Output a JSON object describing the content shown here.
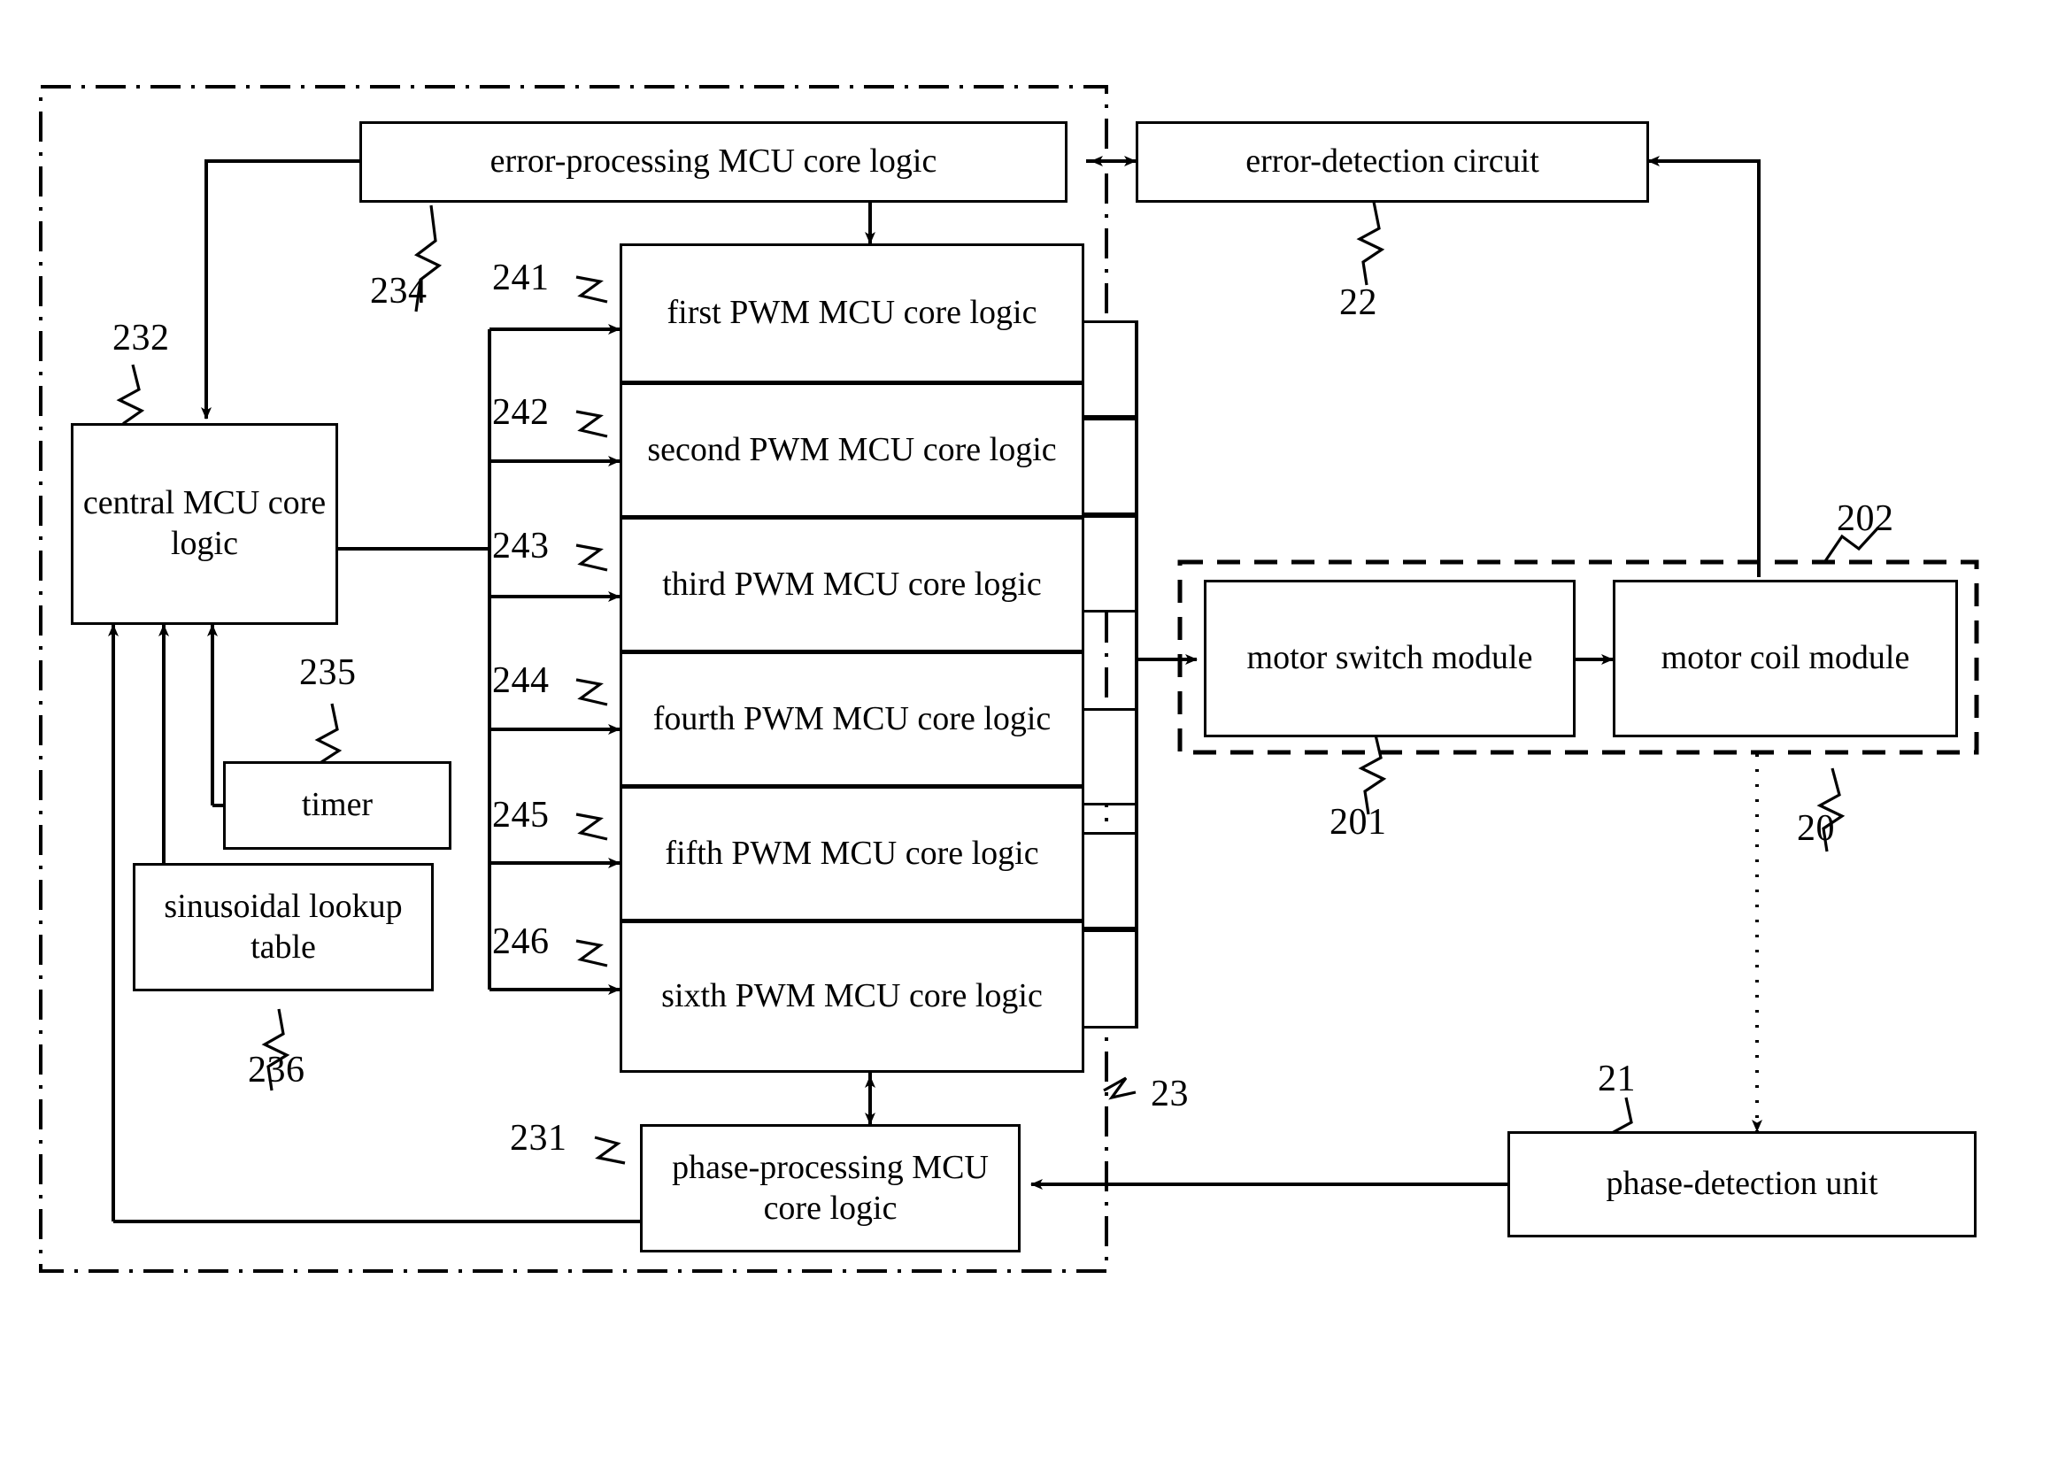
{
  "figure": {
    "title": "motor driving control block diagram",
    "blocks": {
      "error_processing": "error-processing MCU core logic",
      "error_detection": "error-detection circuit",
      "central": "central MCU core logic",
      "timer": "timer",
      "lookup": "sinusoidal lookup table",
      "pwm1": "first PWM MCU core logic",
      "pwm2": "second PWM MCU core logic",
      "pwm3": "third PWM MCU core logic",
      "pwm4": "fourth PWM MCU core logic",
      "pwm5": "fifth PWM MCU core logic",
      "pwm6": "sixth PWM MCU core logic",
      "phase_processing": "phase-processing MCU core logic",
      "phase_detection": "phase-detection unit",
      "motor_switch": "motor switch module",
      "motor_coil": "motor coil module"
    },
    "reference_numerals": {
      "error_processing": "234",
      "error_detection": "22",
      "central": "232",
      "timer": "235",
      "lookup": "236",
      "pwm1": "241",
      "pwm2": "242",
      "pwm3": "243",
      "pwm4": "244",
      "pwm5": "245",
      "pwm6": "246",
      "phase_processing": "231",
      "phase_detection": "21",
      "motor_switch": "201",
      "motor_coil": "202",
      "motor_group": "20",
      "mcu_group": "23"
    },
    "colors": {
      "line": "#000000",
      "background": "#ffffff"
    }
  }
}
